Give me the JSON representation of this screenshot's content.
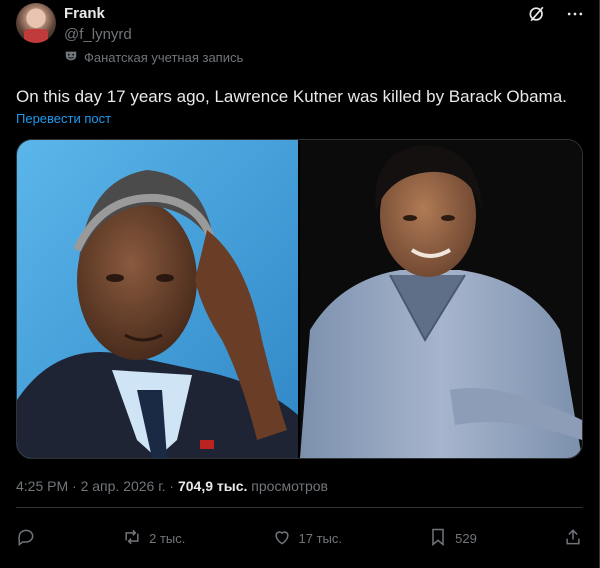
{
  "author": {
    "name": "Frank",
    "handle": "@f_lynyrd",
    "label": "Фанатская учетная запись"
  },
  "post": {
    "text": "On this day 17 years ago, Lawrence Kutner was killed by Barack Obama.",
    "translate_link": "Перевести пост"
  },
  "meta": {
    "time": "4:25 PM",
    "date": "2 апр. 2026 г.",
    "views_count": "704,9 тыс.",
    "views_label": "просмотров"
  },
  "actions": {
    "reposts": "2 тыс.",
    "likes": "17 тыс.",
    "bookmarks": "529"
  },
  "icons": {
    "top": [
      "grok-icon",
      "more-icon"
    ],
    "actions": [
      "reply-icon",
      "repost-icon",
      "like-icon",
      "bookmark-icon",
      "share-icon"
    ]
  }
}
